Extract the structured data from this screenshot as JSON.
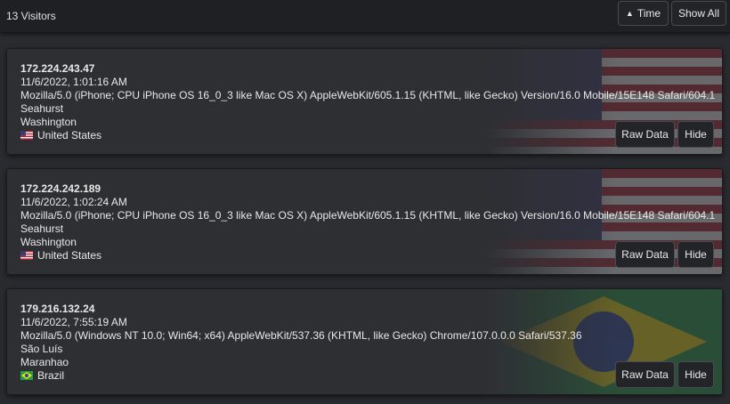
{
  "header": {
    "visitor_count": "13 Visitors",
    "time_label": "Time",
    "show_all_label": "Show All"
  },
  "visitors": [
    {
      "ip": "172.224.243.47",
      "datetime": "11/6/2022, 1:01:16 AM",
      "user_agent": "Mozilla/5.0 (iPhone; CPU iPhone OS 16_0_3 like Mac OS X) AppleWebKit/605.1.15 (KHTML, like Gecko) Version/16.0 Mobile/15E148 Safari/604.1",
      "city": "Seahurst",
      "region": "Washington",
      "country": "United States",
      "flag": "us-flag-icon"
    },
    {
      "ip": "172.224.242.189",
      "datetime": "11/6/2022, 1:02:24 AM",
      "user_agent": "Mozilla/5.0 (iPhone; CPU iPhone OS 16_0_3 like Mac OS X) AppleWebKit/605.1.15 (KHTML, like Gecko) Version/16.0 Mobile/15E148 Safari/604.1",
      "city": "Seahurst",
      "region": "Washington",
      "country": "United States",
      "flag": "us-flag-icon"
    },
    {
      "ip": "179.216.132.24",
      "datetime": "11/6/2022, 7:55:19 AM",
      "user_agent": "Mozilla/5.0 (Windows NT 10.0; Win64; x64) AppleWebKit/537.36 (KHTML, like Gecko) Chrome/107.0.0.0 Safari/537.36",
      "city": "São Luís",
      "region": "Maranhao",
      "country": "Brazil",
      "flag": "br-flag-icon"
    }
  ],
  "card_buttons": {
    "raw_data_label": "Raw Data",
    "hide_label": "Hide"
  },
  "colors": {
    "background": "#2a2b30",
    "card": "#2e2f33",
    "topbar": "#1f2024"
  }
}
